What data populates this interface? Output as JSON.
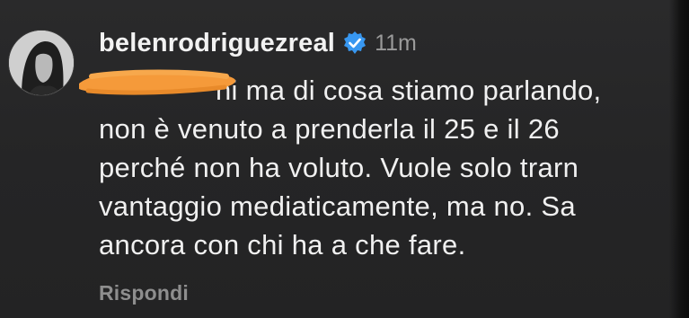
{
  "comment": {
    "username": "belenrodriguezreal",
    "timestamp": "11m",
    "lines": [
      "ni ma di cosa stiamo parlando,",
      "non è venuto a prenderla il 25 e il 26",
      "perché non ha voluto. Vuole solo trarn",
      "vantaggio mediaticamente, ma no. Sa",
      "ancora con chi ha a che fare."
    ],
    "reply_label": "Rispondi"
  },
  "icons": {
    "verified": "verified-badge-icon",
    "avatar": "profile-avatar"
  },
  "colors": {
    "background": "#262627",
    "verified_blue": "#3897f0",
    "redaction_orange": "#f59a3a",
    "secondary_text": "#8e8e8e"
  }
}
